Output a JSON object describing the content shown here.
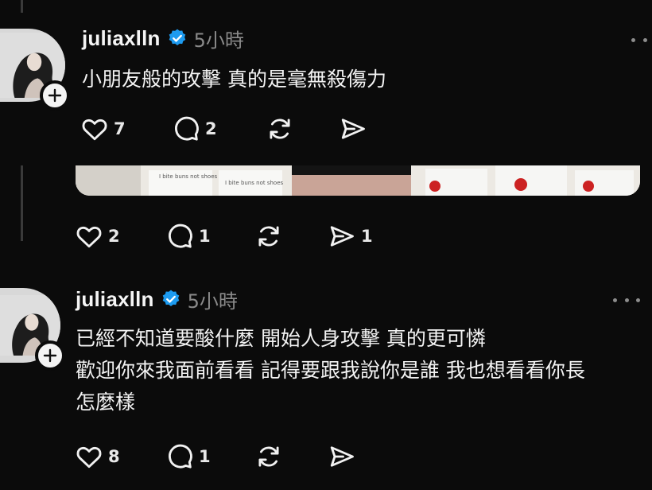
{
  "posts": [
    {
      "username": "juliaxlln",
      "time": "5小時",
      "text_lines": [
        "小朋友般的攻擊 真的是毫無殺傷力"
      ],
      "likes": "7",
      "replies": "2",
      "reposts": "",
      "shares": ""
    },
    {
      "image_texts": [
        "I bite buns not shoes",
        "I bite buns not shoes"
      ],
      "likes": "2",
      "replies": "1",
      "reposts": "",
      "shares": "1"
    },
    {
      "username": "juliaxlln",
      "time": "5小時",
      "text_lines": [
        "已經不知道要酸什麼 開始人身攻擊 真的更可憐",
        "歡迎你來我面前看看 記得要跟我說你是誰 我也想看看你長",
        "怎麼樣"
      ],
      "likes": "8",
      "replies": "1",
      "reposts": "",
      "shares": ""
    }
  ],
  "icons": {
    "verified": "verified-badge-icon",
    "follow": "plus-icon",
    "like": "heart-icon",
    "reply": "comment-icon",
    "repost": "repost-icon",
    "share": "send-icon",
    "more": "more-icon"
  },
  "colors": {
    "background": "#0b0b0b",
    "verified": "#1d9bf0",
    "muted": "#8a8a8a"
  }
}
